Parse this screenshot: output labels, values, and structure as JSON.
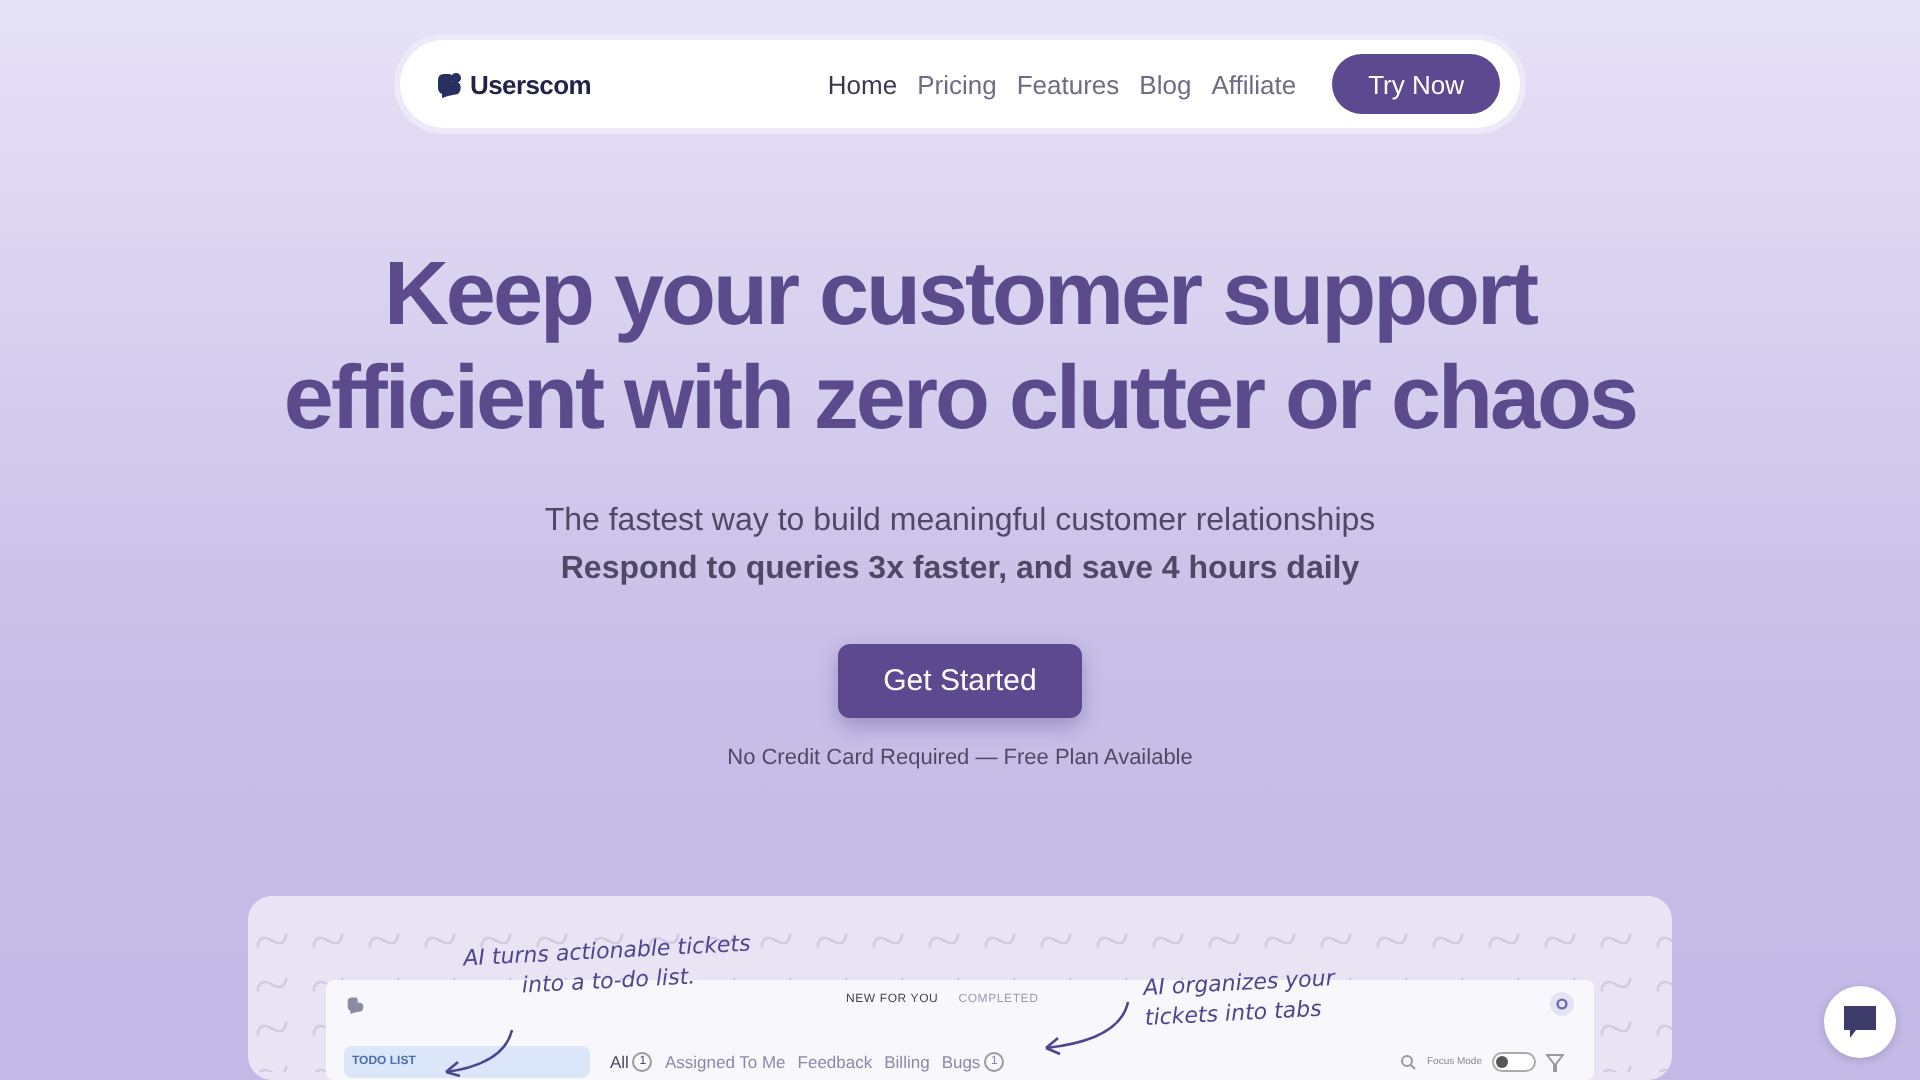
{
  "nav": {
    "logo": "Userscom",
    "links": [
      {
        "label": "Home",
        "selected": true
      },
      {
        "label": "Pricing",
        "selected": false
      },
      {
        "label": "Features",
        "selected": false
      },
      {
        "label": "Blog",
        "selected": false
      },
      {
        "label": "Affiliate",
        "selected": false
      }
    ],
    "cta": "Try Now"
  },
  "hero": {
    "title_lines": [
      "Keep your customer support",
      "efficient with zero clutter or chaos"
    ],
    "subtitle": "The fastest way to build meaningful customer relationships",
    "tagline": "Respond to queries 3x faster, and save 4 hours daily",
    "button": "Get Started",
    "note": "No Credit Card Required — Free Plan Available"
  },
  "preview": {
    "annotations": [
      {
        "kind": "left",
        "lines": [
          "AI turns actionable tickets",
          "into a to-do list."
        ]
      },
      {
        "kind": "right",
        "lines": [
          "AI organizes your",
          "tickets into tabs"
        ]
      }
    ],
    "app": {
      "top_tabs": [
        {
          "label": "NEW FOR YOU",
          "selected": true
        },
        {
          "label": "COMPLETED",
          "selected": false
        }
      ],
      "sidebar_label": "TODO LIST",
      "filters": [
        {
          "label": "All",
          "count": "1",
          "selected": true
        },
        {
          "label": "Assigned To Me",
          "selected": false
        },
        {
          "label": "Feedback",
          "selected": false
        },
        {
          "label": "Billing",
          "selected": false
        },
        {
          "label": "Bugs",
          "count": "1",
          "selected": false
        }
      ],
      "focus_mode": {
        "label": "Focus Mode",
        "on": false
      }
    }
  }
}
